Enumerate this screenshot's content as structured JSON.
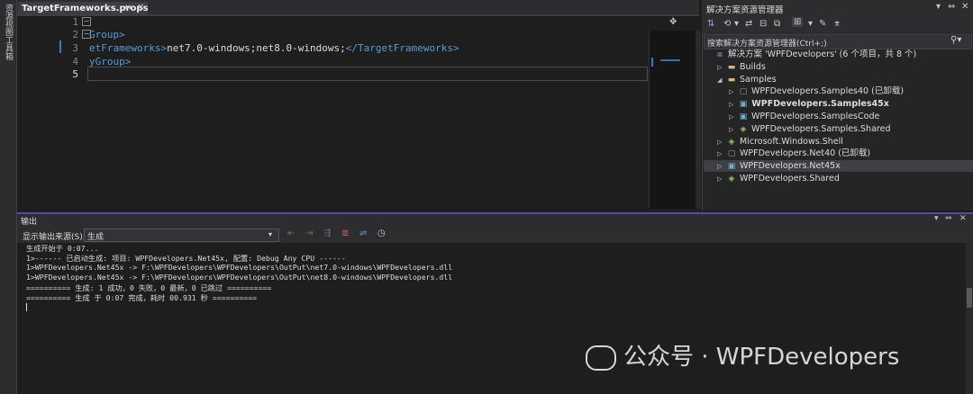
{
  "side_tabs": [
    "资源视图",
    "工具箱"
  ],
  "editor": {
    "tab_title": "TargetFrameworks.props",
    "line_numbers": [
      "1",
      "2",
      "3",
      "4",
      "5"
    ],
    "lines": {
      "l2": "Group>",
      "l3_open": "etFrameworks>",
      "l3_text": "net7.0-windows;net8.0-windows;",
      "l3_close": "</TargetFrameworks>",
      "l4": "yGroup>"
    }
  },
  "solution_explorer": {
    "title": "解决方案资源管理器",
    "search_placeholder": "搜索解决方案资源管理器(Ctrl+;)",
    "items": [
      {
        "label": "解决方案 'WPFDevelopers' (6 个项目，共 8 个)",
        "icon": "solution-icon",
        "indent": 0
      },
      {
        "label": "Builds",
        "icon": "folder-icon",
        "indent": 1
      },
      {
        "label": "Samples",
        "icon": "folder-icon",
        "indent": 1
      },
      {
        "label": "WPFDevelopers.Samples40 (已卸载)",
        "icon": "project-icon",
        "indent": 2
      },
      {
        "label": "WPFDevelopers.Samples45x",
        "icon": "csproj-icon",
        "indent": 2,
        "bold": true
      },
      {
        "label": "WPFDevelopers.SamplesCode",
        "icon": "csproj-icon",
        "indent": 2
      },
      {
        "label": "WPFDevelopers.Samples.Shared",
        "icon": "shared-project-icon",
        "indent": 2
      },
      {
        "label": "Microsoft.Windows.Shell",
        "icon": "shared-project-icon",
        "indent": 1
      },
      {
        "label": "WPFDevelopers.Net40 (已卸载)",
        "icon": "project-icon",
        "indent": 1
      },
      {
        "label": "WPFDevelopers.Net45x",
        "icon": "csproj-icon",
        "indent": 1,
        "selected": true
      },
      {
        "label": "WPFDevelopers.Shared",
        "icon": "shared-project-icon",
        "indent": 1
      }
    ]
  },
  "output": {
    "title": "输出",
    "source_label": "显示输出来源(S):",
    "source_value": "生成",
    "lines": [
      "生成开始于 0:07...",
      "1>------ 已启动生成: 项目: WPFDevelopers.Net45x, 配置: Debug Any CPU ------",
      "1>WPFDevelopers.Net45x -> F:\\WPFDevelopers\\WPFDevelopers\\OutPut\\net7.0-windows\\WPFDevelopers.dll",
      "1>WPFDevelopers.Net45x -> F:\\WPFDevelopers\\WPFDevelopers\\OutPut\\net8.0-windows\\WPFDevelopers.dll",
      "========== 生成: 1 成功，0 失败，0 最新，0 已跳过 ==========",
      "========== 生成 于 0:07 完成，耗时 00.931 秒 =========="
    ]
  },
  "watermark": "公众号 · WPFDevelopers"
}
